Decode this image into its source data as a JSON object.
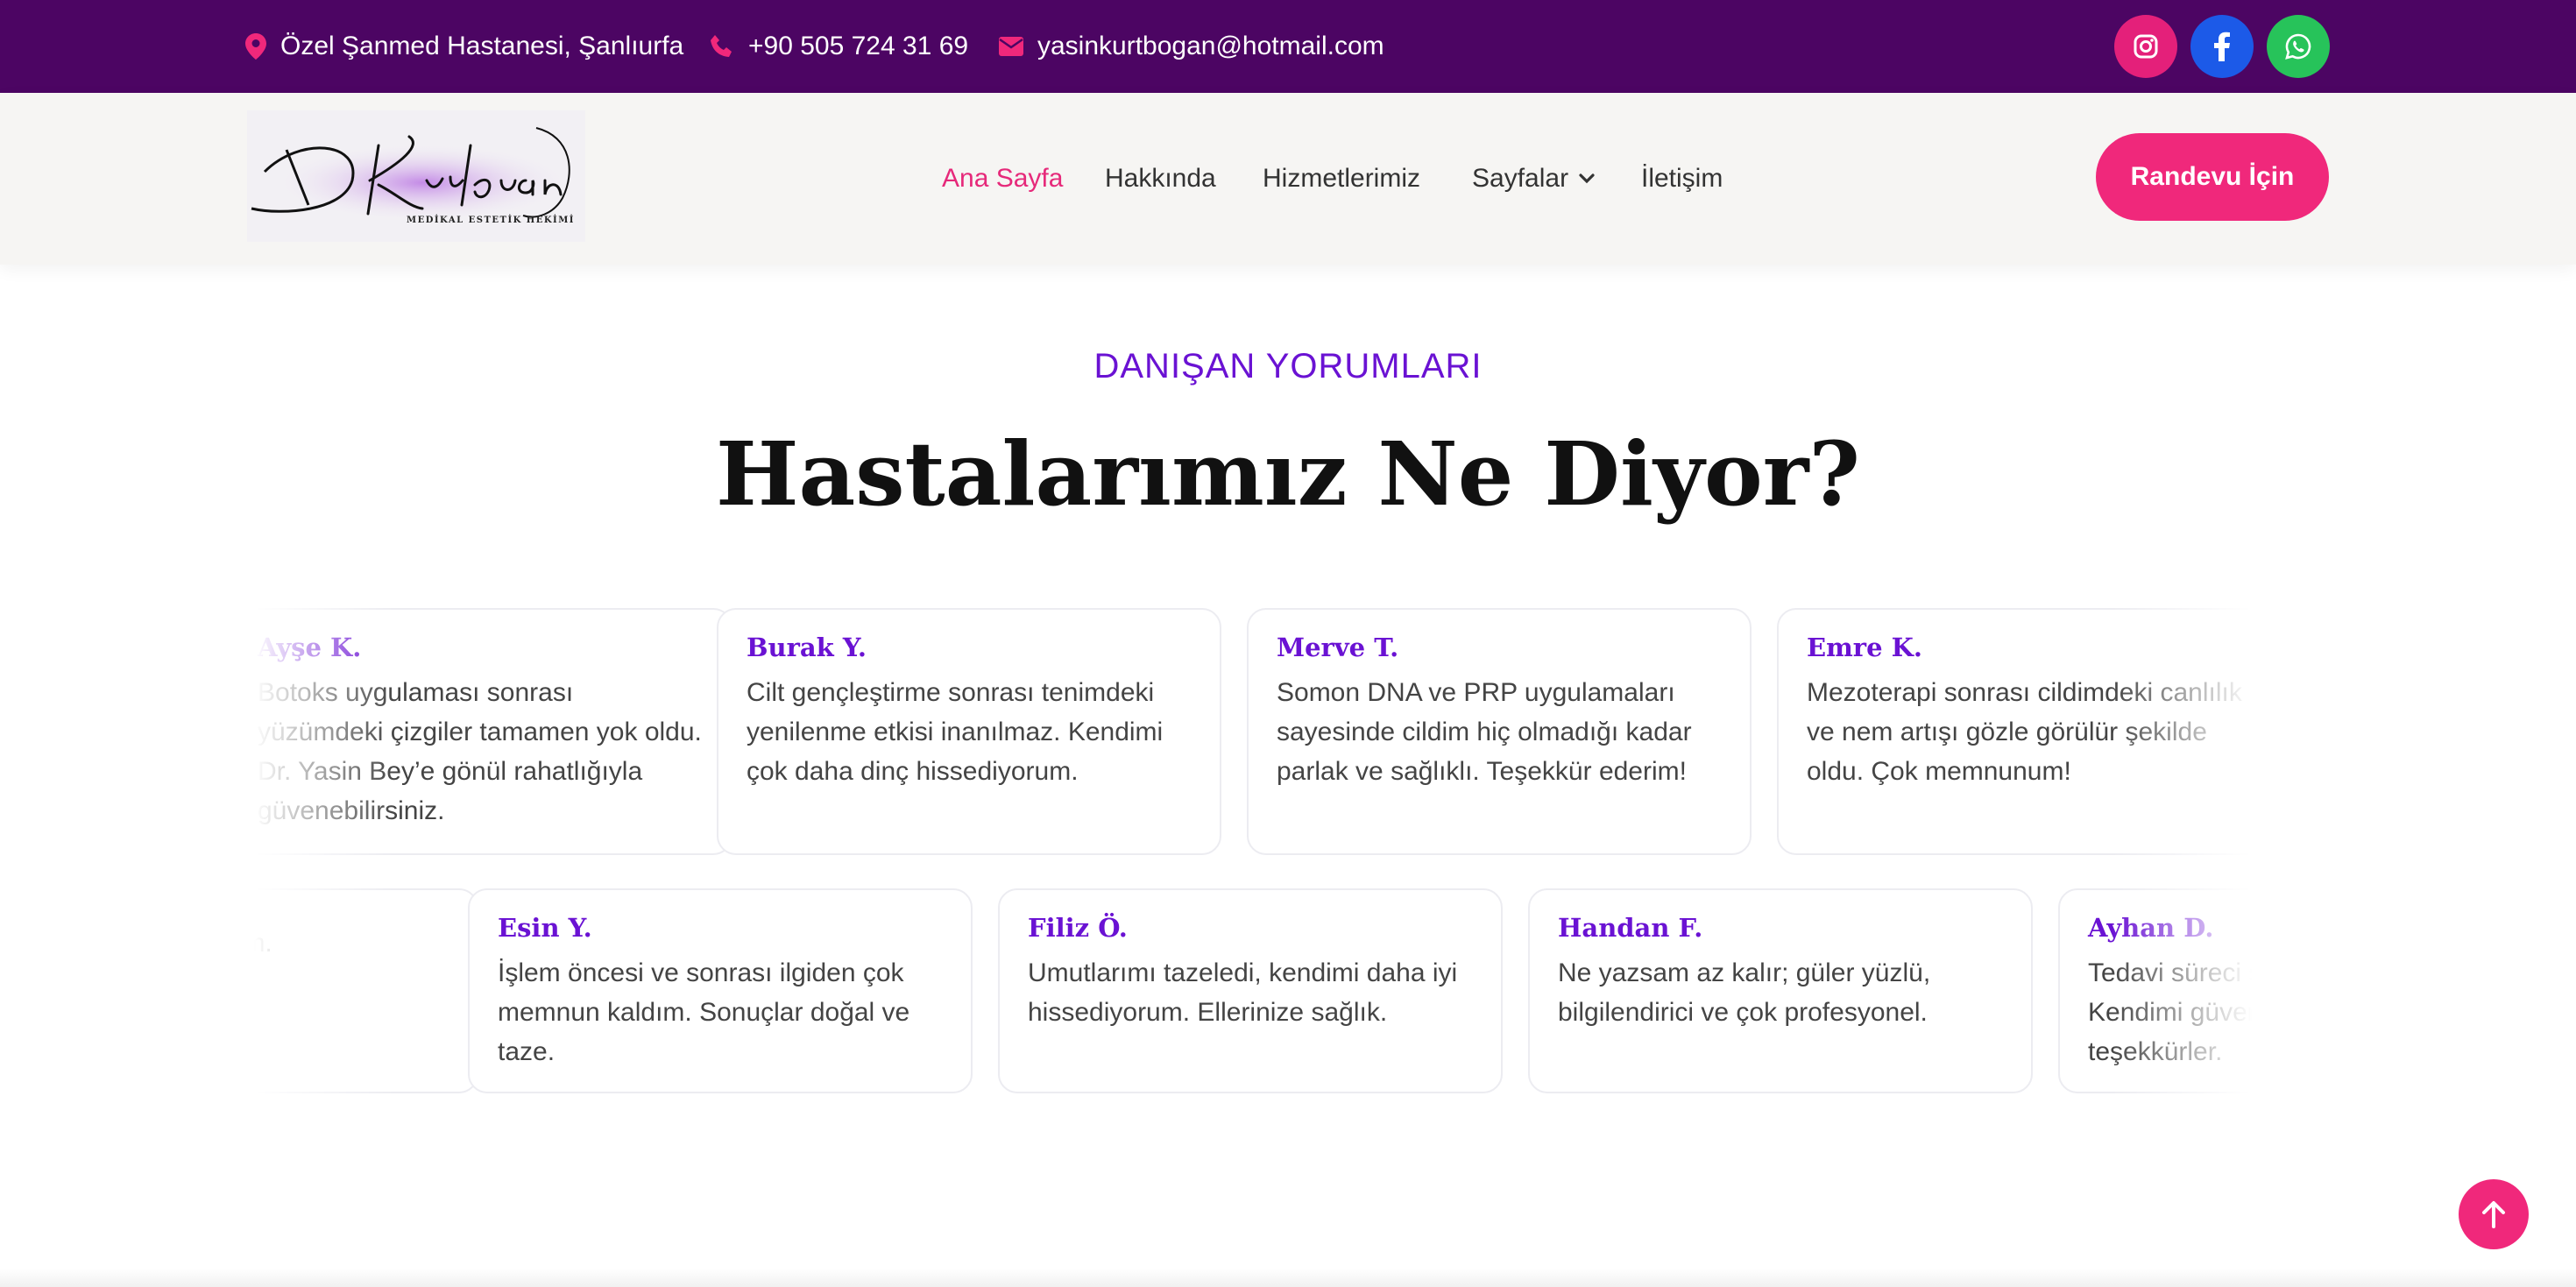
{
  "topbar": {
    "address": "Özel Şanmed Hastanesi, Şanlıurfa",
    "phone": "+90 505 724 31 69",
    "email": "yasinkurtbogan@hotmail.com",
    "social": [
      "instagram-icon",
      "facebook-icon",
      "whatsapp-icon"
    ],
    "bg_color": "#4c0563"
  },
  "header": {
    "logo": {
      "signature": "Dr. Kurtboğan",
      "subtitle": "MEDİKAL ESTETİK HEKİMİ"
    },
    "nav": {
      "home": "Ana Sayfa",
      "about": "Hakkında",
      "services": "Hizmetlerimiz",
      "pages": "Sayfalar",
      "contact": "İletişim"
    },
    "cta": "Randevu İçin",
    "accent_color": "#f0287b"
  },
  "section": {
    "eyebrow": "DANIŞAN YORUMLARI",
    "title": "Hastalarımız Ne Diyor?",
    "accent_color": "#6a12d3"
  },
  "testimonials_row1": [
    {
      "name": "Ayşe K.",
      "text": "Botoks uygulaması sonrası yüzümdeki çizgiler tamamen yok oldu. Dr. Yasin Bey’e gönül rahatlığıyla güvenebilirsiniz."
    },
    {
      "name": "Burak Y.",
      "text": "Cilt gençleştirme sonrası tenimdeki yenilenme etkisi inanılmaz. Kendimi çok daha dinç hissediyorum."
    },
    {
      "name": "Merve T.",
      "text": "Somon DNA ve PRP uygulamaları sayesinde cildim hiç olmadığı kadar parlak ve sağlıklı. Teşekkür ederim!"
    },
    {
      "name": "Emre K.",
      "text": "Mezoterapi sonrası cildimdeki canlılık ve nem artışı gözle görülür şekilde oldu. Çok memnunum!"
    }
  ],
  "testimonials_row2": [
    {
      "name": "",
      "text": "...nlı bir ... memnunum."
    },
    {
      "name": "Esin Y.",
      "text": "İşlem öncesi ve sonrası ilgiden çok memnun kaldım. Sonuçlar doğal ve taze."
    },
    {
      "name": "Filiz Ö.",
      "text": "Umutlarımı tazeledi, kendimi daha iyi hissediyorum. Ellerinize sağlık."
    },
    {
      "name": "Handan F.",
      "text": "Ne yazsam az kalır; güler yüzlü, bilgilendirici ve çok profesyonel."
    },
    {
      "name": "Ayhan D.",
      "text": "Tedavi süreci şeffaf ve açıklayıcıydı. Kendimi güvende hissettim, çok teşekkürler."
    }
  ],
  "back_to_top": "arrow-up-icon"
}
